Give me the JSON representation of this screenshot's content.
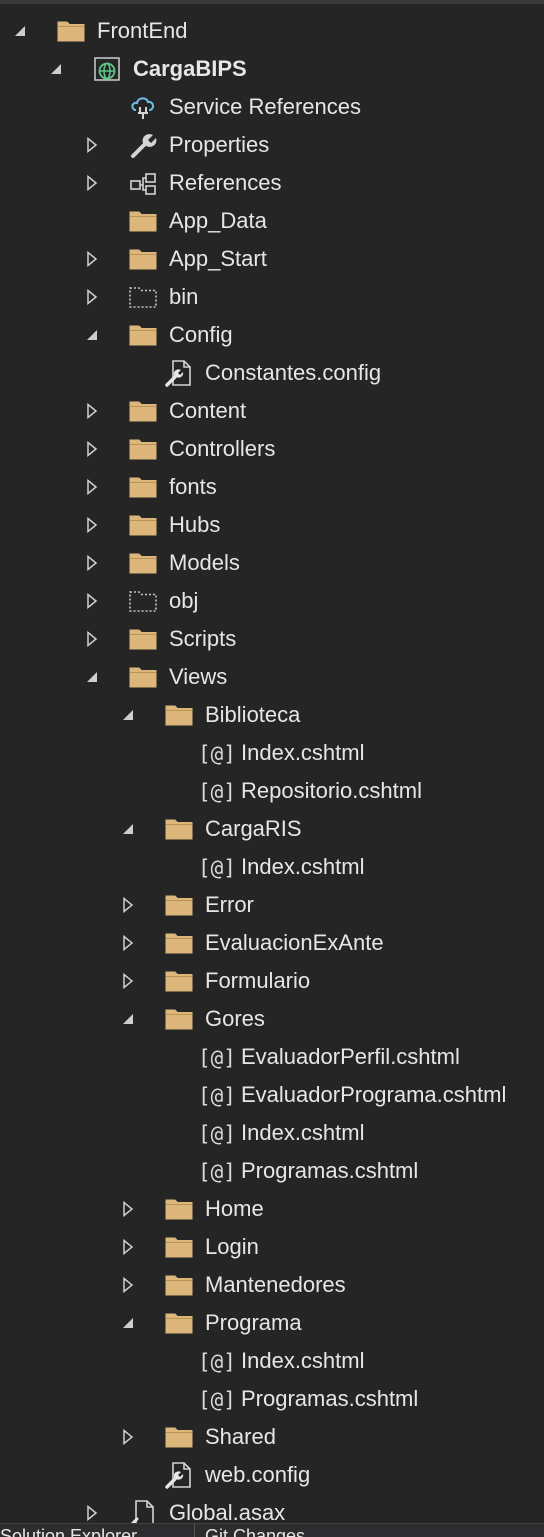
{
  "tree": [
    {
      "depth": 0,
      "expand": "open",
      "icon": "folder-icon",
      "label": "FrontEnd"
    },
    {
      "depth": 1,
      "expand": "open",
      "icon": "web-project-icon",
      "label": "CargaBIPS",
      "bold": true
    },
    {
      "depth": 2,
      "expand": "none",
      "icon": "service-reference-icon",
      "label": "Service References"
    },
    {
      "depth": 2,
      "expand": "closed",
      "icon": "wrench-icon",
      "label": "Properties"
    },
    {
      "depth": 2,
      "expand": "closed",
      "icon": "references-icon",
      "label": "References"
    },
    {
      "depth": 2,
      "expand": "none",
      "icon": "folder-icon",
      "label": "App_Data"
    },
    {
      "depth": 2,
      "expand": "closed",
      "icon": "folder-icon",
      "label": "App_Start"
    },
    {
      "depth": 2,
      "expand": "closed",
      "icon": "dotted-folder-icon",
      "label": "bin"
    },
    {
      "depth": 2,
      "expand": "open",
      "icon": "folder-icon",
      "label": "Config"
    },
    {
      "depth": 3,
      "expand": "none",
      "icon": "config-file-icon",
      "label": "Constantes.config"
    },
    {
      "depth": 2,
      "expand": "closed",
      "icon": "folder-icon",
      "label": "Content"
    },
    {
      "depth": 2,
      "expand": "closed",
      "icon": "folder-icon",
      "label": "Controllers"
    },
    {
      "depth": 2,
      "expand": "closed",
      "icon": "folder-icon",
      "label": "fonts"
    },
    {
      "depth": 2,
      "expand": "closed",
      "icon": "folder-icon",
      "label": "Hubs"
    },
    {
      "depth": 2,
      "expand": "closed",
      "icon": "folder-icon",
      "label": "Models"
    },
    {
      "depth": 2,
      "expand": "closed",
      "icon": "dotted-folder-icon",
      "label": "obj"
    },
    {
      "depth": 2,
      "expand": "closed",
      "icon": "folder-icon",
      "label": "Scripts"
    },
    {
      "depth": 2,
      "expand": "open",
      "icon": "folder-icon",
      "label": "Views"
    },
    {
      "depth": 3,
      "expand": "open",
      "icon": "folder-icon",
      "label": "Biblioteca"
    },
    {
      "depth": 4,
      "expand": "none",
      "icon": "razor-icon",
      "label": "Index.cshtml"
    },
    {
      "depth": 4,
      "expand": "none",
      "icon": "razor-icon",
      "label": "Repositorio.cshtml"
    },
    {
      "depth": 3,
      "expand": "open",
      "icon": "folder-icon",
      "label": "CargaRIS"
    },
    {
      "depth": 4,
      "expand": "none",
      "icon": "razor-icon",
      "label": "Index.cshtml"
    },
    {
      "depth": 3,
      "expand": "closed",
      "icon": "folder-icon",
      "label": "Error"
    },
    {
      "depth": 3,
      "expand": "closed",
      "icon": "folder-icon",
      "label": "EvaluacionExAnte"
    },
    {
      "depth": 3,
      "expand": "closed",
      "icon": "folder-icon",
      "label": "Formulario"
    },
    {
      "depth": 3,
      "expand": "open",
      "icon": "folder-icon",
      "label": "Gores"
    },
    {
      "depth": 4,
      "expand": "none",
      "icon": "razor-icon",
      "label": "EvaluadorPerfil.cshtml"
    },
    {
      "depth": 4,
      "expand": "none",
      "icon": "razor-icon",
      "label": "EvaluadorPrograma.cshtml"
    },
    {
      "depth": 4,
      "expand": "none",
      "icon": "razor-icon",
      "label": "Index.cshtml"
    },
    {
      "depth": 4,
      "expand": "none",
      "icon": "razor-icon",
      "label": "Programas.cshtml"
    },
    {
      "depth": 3,
      "expand": "closed",
      "icon": "folder-icon",
      "label": "Home"
    },
    {
      "depth": 3,
      "expand": "closed",
      "icon": "folder-icon",
      "label": "Login"
    },
    {
      "depth": 3,
      "expand": "closed",
      "icon": "folder-icon",
      "label": "Mantenedores"
    },
    {
      "depth": 3,
      "expand": "open",
      "icon": "folder-icon",
      "label": "Programa"
    },
    {
      "depth": 4,
      "expand": "none",
      "icon": "razor-icon",
      "label": "Index.cshtml"
    },
    {
      "depth": 4,
      "expand": "none",
      "icon": "razor-icon",
      "label": "Programas.cshtml"
    },
    {
      "depth": 3,
      "expand": "closed",
      "icon": "folder-icon",
      "label": "Shared"
    },
    {
      "depth": 3,
      "expand": "none",
      "icon": "config-file-icon",
      "label": "web.config"
    },
    {
      "depth": 2,
      "expand": "closed",
      "icon": "asax-file-icon",
      "label": "Global.asax"
    }
  ],
  "razor_glyph": "[@]",
  "bottom_tabs": [
    {
      "label": "Solution Explorer"
    },
    {
      "label": "Git Changes"
    }
  ],
  "colors": {
    "background": "#252526",
    "text": "#e6e6e6",
    "folder": "#dcb67a",
    "arrow": "#cfcfcf",
    "globe": "#5dc78a",
    "service": "#6cc0ee"
  }
}
